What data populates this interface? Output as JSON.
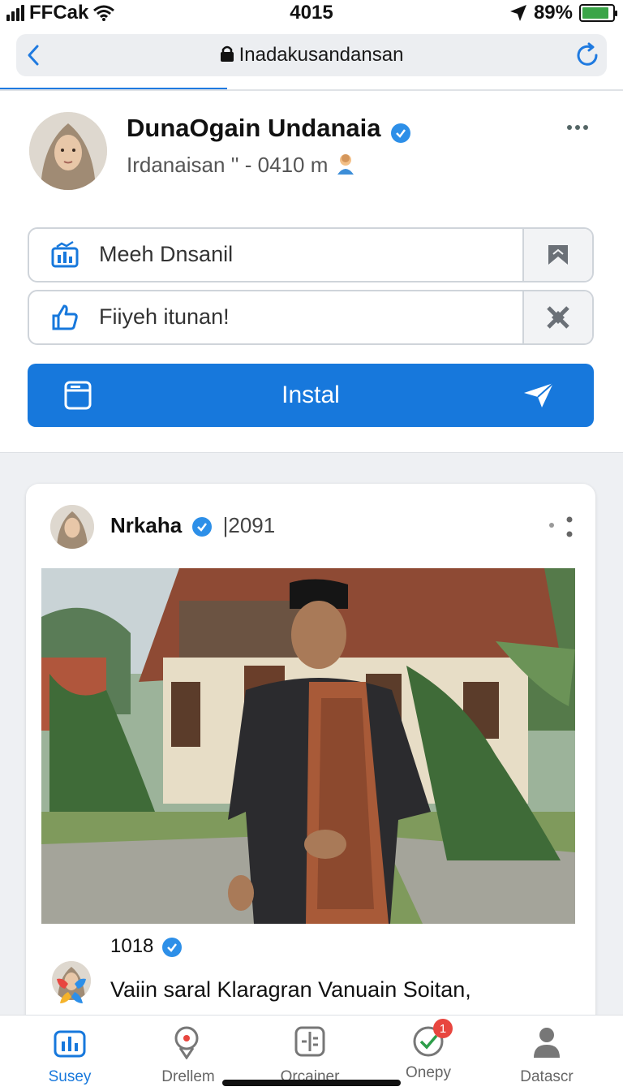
{
  "status_bar": {
    "carrier": "FFCak",
    "time": "4015",
    "battery": "89%",
    "battery_level": 0.89,
    "icons": [
      "signal-bars-icon",
      "wifi-icon",
      "location-arrow-icon",
      "battery-icon"
    ]
  },
  "browser": {
    "url": "Inadakusandansan",
    "icons": [
      "back-chevron-icon",
      "lock-icon",
      "reload-icon"
    ],
    "accent": "#1f7ae0"
  },
  "profile": {
    "name": "DunaOgain Undanaia",
    "subtitle": "Irdanaisan '' - 0410 m",
    "verified": true,
    "more_icon": "more-horizontal-icon"
  },
  "fields": [
    {
      "label": "Meeh Dnsanil",
      "lead_icon": "stats-icon",
      "trail_icon": "bookmark-icon"
    },
    {
      "label": "Fiiyeh itunan!",
      "lead_icon": "thumbs-up-icon",
      "trail_icon": "crossed-out-icon"
    }
  ],
  "install_button": {
    "label": "Instal",
    "lead_icon": "card-icon",
    "trail_icon": "send-icon",
    "color": "#1778dc"
  },
  "post": {
    "author": "Nrkaha",
    "count": "|2091",
    "verified": true,
    "more_icon": "more-dots-icon",
    "photo_alt": "photo",
    "comment_author": "1018",
    "caption": "Vaiin saral Klaragran Vanuain Soitan,"
  },
  "nav": {
    "items": [
      {
        "label": "Susey",
        "icon": "chart-icon",
        "active": true,
        "badge": ""
      },
      {
        "label": "Drellem",
        "icon": "map-pin-icon",
        "active": false,
        "badge": ""
      },
      {
        "label": "Orcainer",
        "icon": "grid-icon",
        "active": false,
        "badge": ""
      },
      {
        "label": "Onepy",
        "icon": "check-circle-icon",
        "active": false,
        "badge": "1"
      },
      {
        "label": "Datascr",
        "icon": "person-icon",
        "active": false,
        "badge": ""
      }
    ],
    "active_color": "#1778dc"
  }
}
